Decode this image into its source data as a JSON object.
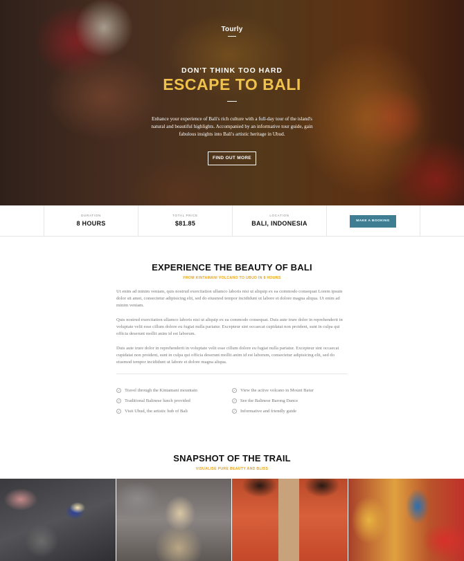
{
  "hero": {
    "brand": "Tourly",
    "tagline": "DON'T THINK TOO HARD",
    "title": "ESCAPE TO BALI",
    "description": "Enhance your experience of Bali's rich culture with a full-day tour of the island's natural and beautiful highlights. Accompanied by an informative tour guide, gain fabulous insights into Bali's artistic heritage in Ubud.",
    "button_label": "FIND OUT MORE"
  },
  "info": {
    "duration": {
      "label": "DURATION",
      "value": "8 HOURS"
    },
    "price": {
      "label": "TOTAL PRICE",
      "value": "$81.85"
    },
    "location": {
      "label": "LOCATION",
      "value": "BALI, INDONESIA"
    },
    "book_label": "MAKE A BOOKING"
  },
  "experience": {
    "title": "EXPERIENCE THE BEAUTY OF BALI",
    "subtitle": "FROM KINTAMANI VOLCANO TO UBUD IN 8 HOURS",
    "paragraphs": [
      "Ut enim ad minim veniam, quis nostrud exercitation ullamco laboris nisi ut aliquip ex ea commodo consequat Lorem ipsum dolor sit amet, consectetur adipisicing elit, sed do eiusmod tempor incididunt ut labore et dolore magna aliqua. Ut enim ad minim veniam.",
      "Quis nostrud exercitation ullamco laboris nisi ut aliquip ex ea commodo consequat. Duis aute irure dolor in reprehenderit in voluptate velit esse cillum dolore eu fugiat nulla pariatur. Excepteur sint occaecat cupidatat non proident, sunt in culpa qui officia deserunt mollit anim id est laborum.",
      "Duis aute irure dolor in reprehenderit in voluptate velit esse cillum dolore eu fugiat nulla pariatur. Excepteur sint occaecat cupidatat non proident, sunt in culpa qui officia deserunt mollit anim id est laborum, consectetur adipisicing elit, sed do eiusmod tempor incididunt ut labore et dolore magna aliqua."
    ],
    "features": [
      "Travel through the Kintamani mountain",
      "View the active volcano in Mount Batur",
      "Traditional Balinese lunch provided",
      "See the Balinese Barong Dance",
      "Visit Ubud, the artistic hub of Bali",
      "Informative and friendly guide"
    ]
  },
  "snapshot": {
    "title": "SNAPSHOT OF THE TRAIL",
    "subtitle": "VISUALISE PURE BEAUTY AND BLISS"
  },
  "colors": {
    "accent": "#f0c14b",
    "subtitle": "#e6a31c",
    "button": "#3f7d93"
  }
}
